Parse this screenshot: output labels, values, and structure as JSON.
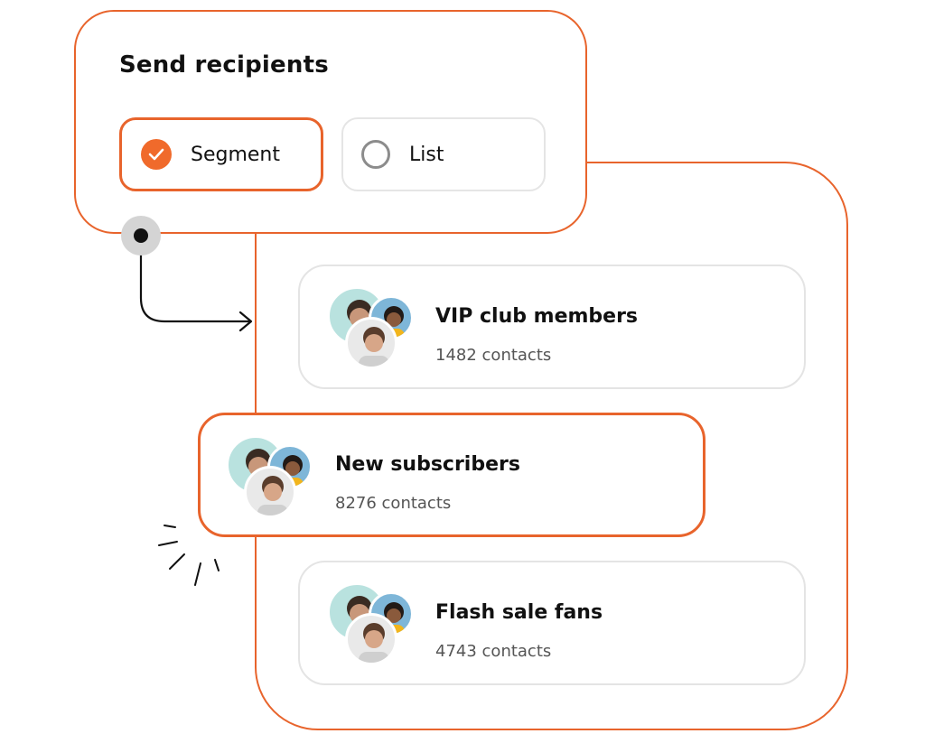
{
  "recipients": {
    "title": "Send recipients",
    "options": [
      {
        "label": "Segment",
        "selected": true
      },
      {
        "label": "List",
        "selected": false
      }
    ]
  },
  "segments": [
    {
      "name": "VIP club members",
      "count": "1482 contacts",
      "selected": false
    },
    {
      "name": "New subscribers",
      "count": "8276 contacts",
      "selected": true
    },
    {
      "name": "Flash sale fans",
      "count": "4743 contacts",
      "selected": false
    }
  ],
  "colors": {
    "accent": "#e8642c",
    "radio_fill": "#f06a2b",
    "border_muted": "#e4e4e4",
    "text_primary": "#111111",
    "text_secondary": "#555555"
  }
}
